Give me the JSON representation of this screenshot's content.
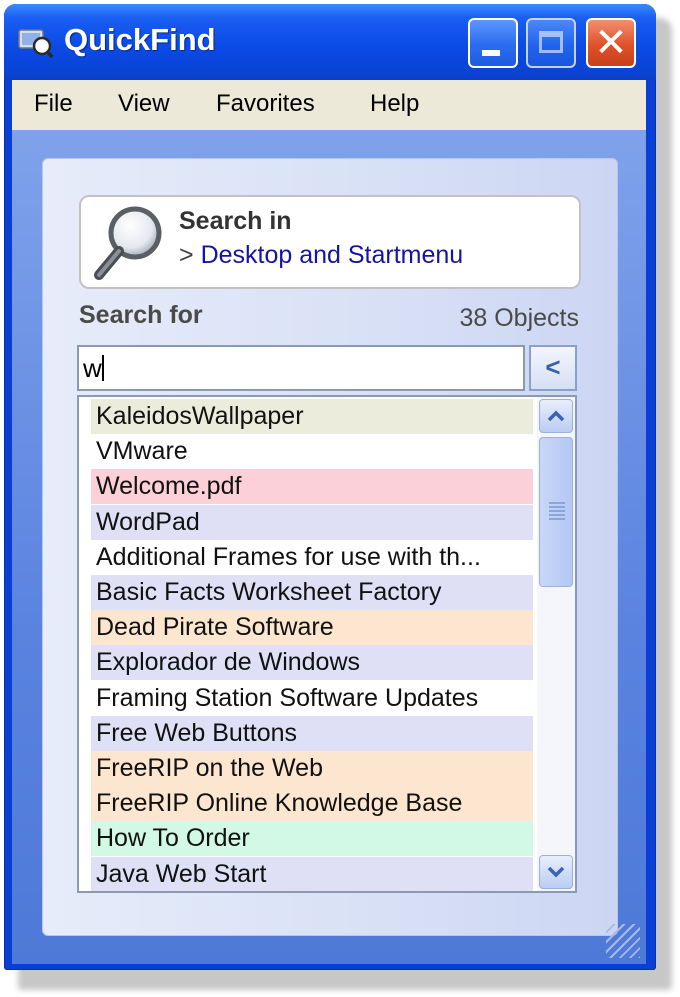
{
  "window": {
    "title": "QuickFind",
    "buttons": {
      "minimize": "minimize",
      "maximize": "maximize",
      "close": "✕"
    }
  },
  "menu": [
    "File",
    "View",
    "Favorites",
    "Help"
  ],
  "search_in": {
    "title": "Search in",
    "prefix": ">",
    "location": "Desktop and Startmenu"
  },
  "search_for": {
    "label": "Search for",
    "count": "38 Objects",
    "value": "w",
    "back_glyph": "<"
  },
  "results": [
    {
      "label": "KaleidosWallpaper",
      "bg": "#ececdc"
    },
    {
      "label": "VMware",
      "bg": "#ffffff"
    },
    {
      "label": "Welcome.pdf",
      "bg": "#fbd0d8"
    },
    {
      "label": "WordPad",
      "bg": "#dfe0f5"
    },
    {
      "label": "Additional Frames for use with th...",
      "bg": "#ffffff"
    },
    {
      "label": "Basic Facts Worksheet Factory",
      "bg": "#dfe0f5"
    },
    {
      "label": "Dead Pirate Software",
      "bg": "#fde6cf"
    },
    {
      "label": "Explorador de Windows",
      "bg": "#dfe0f5"
    },
    {
      "label": "Framing Station Software Updates",
      "bg": "#ffffff"
    },
    {
      "label": "Free Web Buttons",
      "bg": "#dfe0f5"
    },
    {
      "label": "FreeRIP on the Web",
      "bg": "#fde6cf"
    },
    {
      "label": "FreeRIP Online Knowledge Base",
      "bg": "#fde6cf"
    },
    {
      "label": "How To Order",
      "bg": "#d2f8e6"
    },
    {
      "label": "Java Web Start",
      "bg": "#dfe0f5"
    }
  ],
  "icons": {
    "app": "app-icon",
    "search": "magnifier-icon",
    "scroll_up": "chevron-up-icon",
    "scroll_down": "chevron-down-icon"
  },
  "colors": {
    "titlebar": "#0c4be6",
    "menubar": "#ece9d8",
    "location_link": "#1414a0"
  }
}
